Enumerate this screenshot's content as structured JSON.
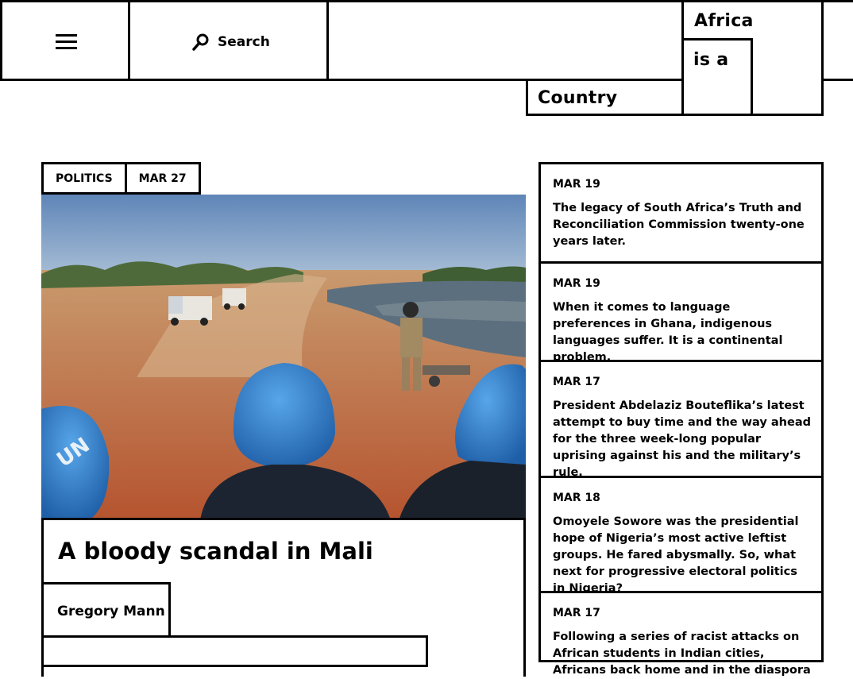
{
  "header": {
    "menu_icon": "hamburger-icon",
    "search_icon": "search-icon",
    "search_label": "Search",
    "logo": {
      "line1": "Africa",
      "line2": "is a",
      "line3": "Country"
    }
  },
  "featured": {
    "category": "POLITICS",
    "date": "MAR 27",
    "image_alt": "UN peacekeepers in blue helmets overlooking a dirt road with trucks in Mali",
    "title": "A bloody scandal in Mali",
    "author": "Gregory Mann"
  },
  "sidebar": {
    "items": [
      {
        "date": "MAR 19",
        "headline": "The legacy of South Africa’s Truth and Reconciliation Commission twenty-one years later."
      },
      {
        "date": "MAR 19",
        "headline": "When it comes to language preferences in Ghana, indigenous languages suffer. It is a continental problem."
      },
      {
        "date": "MAR 17",
        "headline": "President Abdelaziz Bouteflika’s latest attempt to buy time and the way ahead for the three week-long popular uprising against his and the military’s rule."
      },
      {
        "date": "MAR 18",
        "headline": "Omoyele Sowore was the presidential hope of Nigeria’s most active leftist groups. He fared abysmally. So, what next for progressive electoral politics in Nigeria?"
      },
      {
        "date": "MAR 17",
        "headline": "Following a series of racist attacks on African students in Indian cities, Africans back home and in the diaspora"
      }
    ]
  }
}
